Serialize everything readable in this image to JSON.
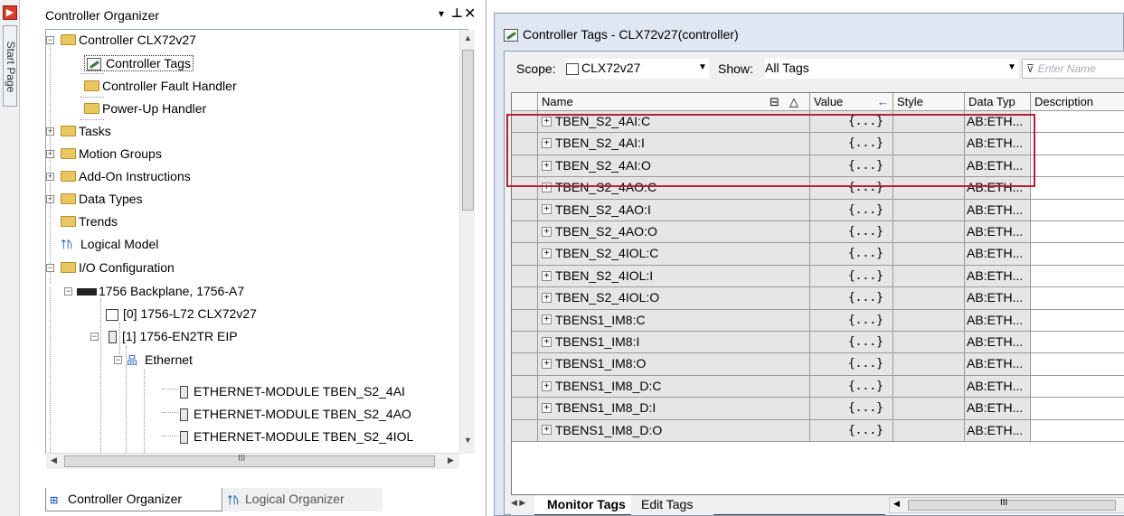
{
  "start_page": {
    "label": "Start Page"
  },
  "organizer": {
    "title": "Controller Organizer",
    "pin_glyph": "▾",
    "pin2_glyph": "⊥",
    "close_glyph": "✕",
    "tree": [
      {
        "label": "Controller CLX72v27",
        "icon": "folder-icon"
      },
      {
        "label": "Controller Tags",
        "icon": "tag-icon",
        "selected": true
      },
      {
        "label": "Controller Fault Handler",
        "icon": "folder-icon"
      },
      {
        "label": "Power-Up Handler",
        "icon": "folder-icon"
      },
      {
        "label": "Tasks",
        "icon": "folder-icon"
      },
      {
        "label": "Motion Groups",
        "icon": "folder-icon"
      },
      {
        "label": "Add-On Instructions",
        "icon": "folder-icon"
      },
      {
        "label": "Data Types",
        "icon": "folder-icon"
      },
      {
        "label": "Trends",
        "icon": "folder-icon"
      },
      {
        "label": "Logical Model",
        "icon": "logical-model-icon"
      },
      {
        "label": "I/O Configuration",
        "icon": "folder-icon"
      },
      {
        "label": "1756 Backplane, 1756-A7",
        "icon": "backplane-icon"
      },
      {
        "label": "[0] 1756-L72 CLX72v27",
        "icon": "controller-icon"
      },
      {
        "label": "[1] 1756-EN2TR EIP",
        "icon": "module-icon"
      },
      {
        "label": "Ethernet",
        "icon": "ethernet-icon"
      },
      {
        "label": "ETHERNET-MODULE TBEN_S2_4AI",
        "icon": "module-icon"
      },
      {
        "label": "ETHERNET-MODULE TBEN_S2_4AO",
        "icon": "module-icon"
      },
      {
        "label": "ETHERNET-MODULE TBEN_S2_4IOL",
        "icon": "module-icon"
      }
    ],
    "hscroll_grip": "III",
    "tabs": {
      "controller": "Controller Organizer",
      "logical": "Logical Organizer"
    }
  },
  "tags_window": {
    "title": "Controller Tags - CLX72v27(controller)",
    "scope_label": "Scope:",
    "scope_value": "CLX72v27",
    "show_label": "Show:",
    "show_value": "All Tags",
    "filter_placeholder": "Enter Name",
    "columns": {
      "name": "Name",
      "sort_glyph": "△",
      "value": "Value",
      "value_arrow": "←",
      "style": "Style",
      "data_type": "Data Typ",
      "description": "Description"
    },
    "rows": [
      {
        "name": "TBEN_S2_4AI:C",
        "value": "{...}",
        "type": "AB:ETH..."
      },
      {
        "name": "TBEN_S2_4AI:I",
        "value": "{...}",
        "type": "AB:ETH..."
      },
      {
        "name": "TBEN_S2_4AI:O",
        "value": "{...}",
        "type": "AB:ETH..."
      },
      {
        "name": "TBEN_S2_4AO:C",
        "value": "{...}",
        "type": "AB:ETH..."
      },
      {
        "name": "TBEN_S2_4AO:I",
        "value": "{...}",
        "type": "AB:ETH..."
      },
      {
        "name": "TBEN_S2_4AO:O",
        "value": "{...}",
        "type": "AB:ETH..."
      },
      {
        "name": "TBEN_S2_4IOL:C",
        "value": "{...}",
        "type": "AB:ETH..."
      },
      {
        "name": "TBEN_S2_4IOL:I",
        "value": "{...}",
        "type": "AB:ETH..."
      },
      {
        "name": "TBEN_S2_4IOL:O",
        "value": "{...}",
        "type": "AB:ETH..."
      },
      {
        "name": "TBENS1_IM8:C",
        "value": "{...}",
        "type": "AB:ETH..."
      },
      {
        "name": "TBENS1_IM8:I",
        "value": "{...}",
        "type": "AB:ETH..."
      },
      {
        "name": "TBENS1_IM8:O",
        "value": "{...}",
        "type": "AB:ETH..."
      },
      {
        "name": "TBENS1_IM8_D:C",
        "value": "{...}",
        "type": "AB:ETH..."
      },
      {
        "name": "TBENS1_IM8_D:I",
        "value": "{...}",
        "type": "AB:ETH..."
      },
      {
        "name": "TBENS1_IM8_D:O",
        "value": "{...}",
        "type": "AB:ETH..."
      }
    ],
    "tabs": {
      "monitor": "Monitor Tags",
      "edit": "Edit Tags"
    },
    "hscroll_grip": "III",
    "highlight_color": "#b22234"
  }
}
